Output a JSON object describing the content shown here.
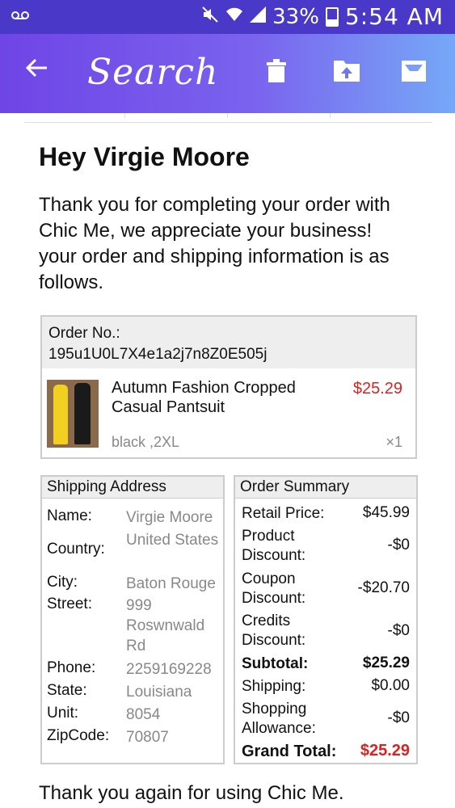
{
  "status_bar": {
    "voicemail_icon": "voicemail-icon",
    "battery": "33%",
    "time": "5:54 AM"
  },
  "app_bar": {
    "title": "Search",
    "back_icon": "arrow-left-icon",
    "delete_icon": "trash-icon",
    "move_icon": "folder-upload-icon",
    "archive_icon": "archive-icon",
    "gradient": [
      "#6f45e6",
      "#76a8f7"
    ]
  },
  "email": {
    "greeting": "Hey Virgie Moore",
    "intro": "Thank you for completing your order with Chic Me, we appreciate your business! your order and shipping information is as follows.",
    "order": {
      "label": "Order No.:",
      "number": "195u1U0L7X4e1a2j7n8Z0E505j",
      "product_name": "Autumn Fashion Cropped Casual Pantsuit",
      "price": "$25.29",
      "variant": "black ,2XL",
      "quantity": "×1"
    },
    "shipping": {
      "title": "Shipping Address",
      "rows": [
        {
          "label": "Name:",
          "value": "Virgie Moore"
        },
        {
          "label": "Country:",
          "value": "United States"
        },
        {
          "label": "City:",
          "value": "Baton Rouge"
        },
        {
          "label": "Street:",
          "value": "999 Roswnwald Rd"
        },
        {
          "label": "Phone:",
          "value": "2259169228"
        },
        {
          "label": "State:",
          "value": "Louisiana"
        },
        {
          "label": "Unit:",
          "value": "8054"
        },
        {
          "label": "ZipCode:",
          "value": "70807"
        }
      ]
    },
    "summary": {
      "title": "Order Summary",
      "rows": [
        {
          "label": "Retail Price:",
          "value": "$45.99"
        },
        {
          "label": "Product Discount:",
          "value": "-$0"
        },
        {
          "label": "Coupon Discount:",
          "value": "-$20.70"
        },
        {
          "label": "Credits Discount:",
          "value": "-$0"
        },
        {
          "label": "Subtotal:",
          "value": "$25.29"
        },
        {
          "label": "Shipping:",
          "value": "$0.00"
        },
        {
          "label": "Shopping Allowance:",
          "value": "-$0"
        },
        {
          "label": "Grand Total:",
          "value": "$25.29"
        }
      ]
    },
    "footer": "Thank you again for using Chic Me."
  },
  "colors": {
    "status_bar": "#4a39c9",
    "price_red": "#e02020",
    "muted_text": "#888888"
  }
}
